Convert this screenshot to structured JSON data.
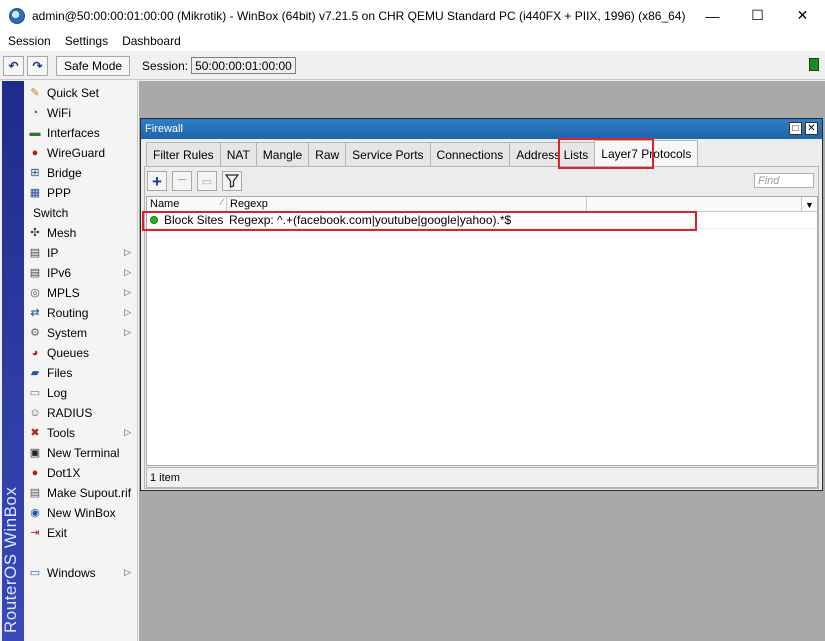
{
  "window": {
    "title": "admin@50:00:00:01:00:00 (Mikrotik) - WinBox (64bit) v7.21.5 on CHR QEMU Standard PC (i440FX + PIIX, 1996) (x86_64)",
    "minimize": "—",
    "maximize": "☐",
    "close": "✕"
  },
  "menu": [
    "Session",
    "Settings",
    "Dashboard"
  ],
  "toolbar": {
    "undo_icon": "↶",
    "redo_icon": "↷",
    "safe_mode": "Safe Mode",
    "session_label": "Session:",
    "session_value": "50:00:00:01:00:00"
  },
  "branding": "RouterOS WinBox",
  "sidebar": {
    "items": [
      {
        "label": "Quick Set",
        "icon": "wand-icon",
        "glyph": "✎",
        "color": "#b8860b",
        "sub": false
      },
      {
        "label": "WiFi",
        "icon": "wifi-icon",
        "glyph": "◔",
        "color": "#555555",
        "sub": false
      },
      {
        "label": "Interfaces",
        "icon": "interfaces-icon",
        "glyph": "▬",
        "color": "#2a7a2a",
        "sub": false
      },
      {
        "label": "WireGuard",
        "icon": "wireguard-icon",
        "glyph": "●",
        "color": "#b22222",
        "sub": false
      },
      {
        "label": "Bridge",
        "icon": "bridge-icon",
        "glyph": "⊞",
        "color": "#1a4c8c",
        "sub": false
      },
      {
        "label": "PPP",
        "icon": "ppp-icon",
        "glyph": "▦",
        "color": "#1a4c8c",
        "sub": false
      },
      {
        "label": "Switch",
        "icon": "",
        "glyph": "",
        "color": "#000000",
        "sub": false
      },
      {
        "label": "Mesh",
        "icon": "mesh-icon",
        "glyph": "✣",
        "color": "#333333",
        "sub": false
      },
      {
        "label": "IP",
        "icon": "ip-icon",
        "glyph": "▤",
        "color": "#444444",
        "sub": true
      },
      {
        "label": "IPv6",
        "icon": "ipv6-icon",
        "glyph": "▤",
        "color": "#444444",
        "sub": true
      },
      {
        "label": "MPLS",
        "icon": "mpls-icon",
        "glyph": "◎",
        "color": "#555555",
        "sub": true
      },
      {
        "label": "Routing",
        "icon": "routing-icon",
        "glyph": "⇄",
        "color": "#1a4c8c",
        "sub": true
      },
      {
        "label": "System",
        "icon": "system-icon",
        "glyph": "⚙",
        "color": "#666666",
        "sub": true
      },
      {
        "label": "Queues",
        "icon": "queues-icon",
        "glyph": "◕",
        "color": "#b22222",
        "sub": false
      },
      {
        "label": "Files",
        "icon": "files-icon",
        "glyph": "▰",
        "color": "#1a5c9c",
        "sub": false
      },
      {
        "label": "Log",
        "icon": "log-icon",
        "glyph": "▭",
        "color": "#777777",
        "sub": false
      },
      {
        "label": "RADIUS",
        "icon": "radius-icon",
        "glyph": "☺",
        "color": "#555555",
        "sub": false
      },
      {
        "label": "Tools",
        "icon": "tools-icon",
        "glyph": "✖",
        "color": "#b22222",
        "sub": true
      },
      {
        "label": "New Terminal",
        "icon": "terminal-icon",
        "glyph": "▣",
        "color": "#222222",
        "sub": false
      },
      {
        "label": "Dot1X",
        "icon": "dot1x-icon",
        "glyph": "●",
        "color": "#b22222",
        "sub": false
      },
      {
        "label": "Make Supout.rif",
        "icon": "supout-icon",
        "glyph": "▤",
        "color": "#555555",
        "sub": false
      },
      {
        "label": "New WinBox",
        "icon": "winbox-icon",
        "glyph": "◉",
        "color": "#1a5c9c",
        "sub": false
      },
      {
        "label": "Exit",
        "icon": "exit-icon",
        "glyph": "⇥",
        "color": "#b22222",
        "sub": false
      },
      {
        "label": "Windows",
        "icon": "windows-icon",
        "glyph": "▭",
        "color": "#1a5c9c",
        "sub": true
      }
    ]
  },
  "firewall": {
    "title": "Firewall",
    "tabs": [
      {
        "label": "Filter Rules",
        "active": false
      },
      {
        "label": "NAT",
        "active": false
      },
      {
        "label": "Mangle",
        "active": false
      },
      {
        "label": "Raw",
        "active": false
      },
      {
        "label": "Service Ports",
        "active": false
      },
      {
        "label": "Connections",
        "active": false
      },
      {
        "label": "Address Lists",
        "active": false
      },
      {
        "label": "Layer7 Protocols",
        "active": true
      }
    ],
    "find_placeholder": "Find",
    "columns": [
      "Name",
      "Regexp"
    ],
    "rows": [
      {
        "name": "Block Sites",
        "regexp": "Regexp: ^.+(facebook.com|youtube|google|yahoo).*$"
      }
    ],
    "status": "1 item"
  }
}
